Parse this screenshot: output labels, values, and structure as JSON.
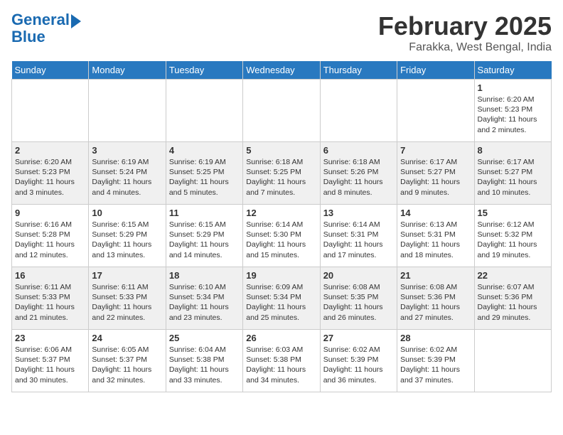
{
  "header": {
    "logo_line1": "General",
    "logo_line2": "Blue",
    "month": "February 2025",
    "location": "Farakka, West Bengal, India"
  },
  "days_of_week": [
    "Sunday",
    "Monday",
    "Tuesday",
    "Wednesday",
    "Thursday",
    "Friday",
    "Saturday"
  ],
  "weeks": [
    [
      {
        "day": "",
        "info": ""
      },
      {
        "day": "",
        "info": ""
      },
      {
        "day": "",
        "info": ""
      },
      {
        "day": "",
        "info": ""
      },
      {
        "day": "",
        "info": ""
      },
      {
        "day": "",
        "info": ""
      },
      {
        "day": "1",
        "info": "Sunrise: 6:20 AM\nSunset: 5:23 PM\nDaylight: 11 hours\nand 2 minutes."
      }
    ],
    [
      {
        "day": "2",
        "info": "Sunrise: 6:20 AM\nSunset: 5:23 PM\nDaylight: 11 hours\nand 3 minutes."
      },
      {
        "day": "3",
        "info": "Sunrise: 6:19 AM\nSunset: 5:24 PM\nDaylight: 11 hours\nand 4 minutes."
      },
      {
        "day": "4",
        "info": "Sunrise: 6:19 AM\nSunset: 5:25 PM\nDaylight: 11 hours\nand 5 minutes."
      },
      {
        "day": "5",
        "info": "Sunrise: 6:18 AM\nSunset: 5:25 PM\nDaylight: 11 hours\nand 7 minutes."
      },
      {
        "day": "6",
        "info": "Sunrise: 6:18 AM\nSunset: 5:26 PM\nDaylight: 11 hours\nand 8 minutes."
      },
      {
        "day": "7",
        "info": "Sunrise: 6:17 AM\nSunset: 5:27 PM\nDaylight: 11 hours\nand 9 minutes."
      },
      {
        "day": "8",
        "info": "Sunrise: 6:17 AM\nSunset: 5:27 PM\nDaylight: 11 hours\nand 10 minutes."
      }
    ],
    [
      {
        "day": "9",
        "info": "Sunrise: 6:16 AM\nSunset: 5:28 PM\nDaylight: 11 hours\nand 12 minutes."
      },
      {
        "day": "10",
        "info": "Sunrise: 6:15 AM\nSunset: 5:29 PM\nDaylight: 11 hours\nand 13 minutes."
      },
      {
        "day": "11",
        "info": "Sunrise: 6:15 AM\nSunset: 5:29 PM\nDaylight: 11 hours\nand 14 minutes."
      },
      {
        "day": "12",
        "info": "Sunrise: 6:14 AM\nSunset: 5:30 PM\nDaylight: 11 hours\nand 15 minutes."
      },
      {
        "day": "13",
        "info": "Sunrise: 6:14 AM\nSunset: 5:31 PM\nDaylight: 11 hours\nand 17 minutes."
      },
      {
        "day": "14",
        "info": "Sunrise: 6:13 AM\nSunset: 5:31 PM\nDaylight: 11 hours\nand 18 minutes."
      },
      {
        "day": "15",
        "info": "Sunrise: 6:12 AM\nSunset: 5:32 PM\nDaylight: 11 hours\nand 19 minutes."
      }
    ],
    [
      {
        "day": "16",
        "info": "Sunrise: 6:11 AM\nSunset: 5:33 PM\nDaylight: 11 hours\nand 21 minutes."
      },
      {
        "day": "17",
        "info": "Sunrise: 6:11 AM\nSunset: 5:33 PM\nDaylight: 11 hours\nand 22 minutes."
      },
      {
        "day": "18",
        "info": "Sunrise: 6:10 AM\nSunset: 5:34 PM\nDaylight: 11 hours\nand 23 minutes."
      },
      {
        "day": "19",
        "info": "Sunrise: 6:09 AM\nSunset: 5:34 PM\nDaylight: 11 hours\nand 25 minutes."
      },
      {
        "day": "20",
        "info": "Sunrise: 6:08 AM\nSunset: 5:35 PM\nDaylight: 11 hours\nand 26 minutes."
      },
      {
        "day": "21",
        "info": "Sunrise: 6:08 AM\nSunset: 5:36 PM\nDaylight: 11 hours\nand 27 minutes."
      },
      {
        "day": "22",
        "info": "Sunrise: 6:07 AM\nSunset: 5:36 PM\nDaylight: 11 hours\nand 29 minutes."
      }
    ],
    [
      {
        "day": "23",
        "info": "Sunrise: 6:06 AM\nSunset: 5:37 PM\nDaylight: 11 hours\nand 30 minutes."
      },
      {
        "day": "24",
        "info": "Sunrise: 6:05 AM\nSunset: 5:37 PM\nDaylight: 11 hours\nand 32 minutes."
      },
      {
        "day": "25",
        "info": "Sunrise: 6:04 AM\nSunset: 5:38 PM\nDaylight: 11 hours\nand 33 minutes."
      },
      {
        "day": "26",
        "info": "Sunrise: 6:03 AM\nSunset: 5:38 PM\nDaylight: 11 hours\nand 34 minutes."
      },
      {
        "day": "27",
        "info": "Sunrise: 6:02 AM\nSunset: 5:39 PM\nDaylight: 11 hours\nand 36 minutes."
      },
      {
        "day": "28",
        "info": "Sunrise: 6:02 AM\nSunset: 5:39 PM\nDaylight: 11 hours\nand 37 minutes."
      },
      {
        "day": "",
        "info": ""
      }
    ]
  ]
}
